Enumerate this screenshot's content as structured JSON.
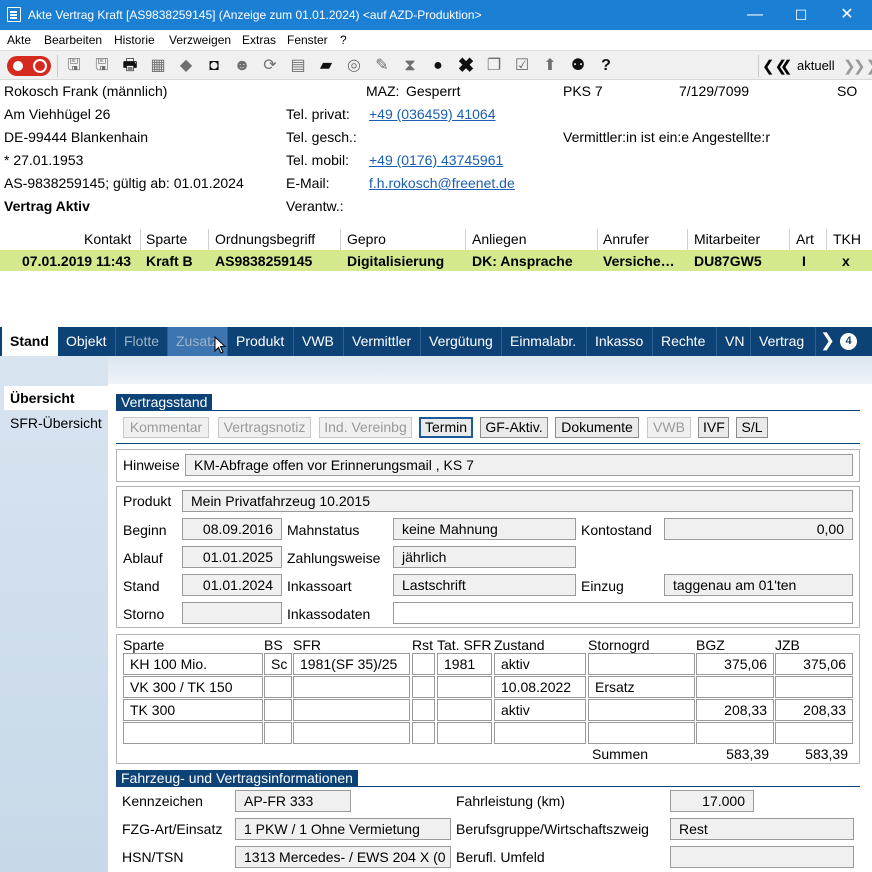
{
  "window": {
    "title": "Akte Vertrag Kraft [AS9838259145] (Anzeige zum 01.01.2024) <auf AZD-Produktion>",
    "min": "—",
    "max": "☐",
    "close": "✕"
  },
  "menu": [
    "Akte",
    "Bearbeiten",
    "Historie",
    "Verzweigen",
    "Extras",
    "Fenster",
    "?"
  ],
  "toolbar": {
    "icons": [
      "save-icon",
      "save-as-icon",
      "print-icon",
      "calculator-icon",
      "tag-icon",
      "note-icon",
      "agent-icon",
      "refresh-icon",
      "document-icon",
      "folder-icon",
      "coins-icon",
      "edit-document-icon",
      "hourglass-icon",
      "person-icon",
      "x-cross-icon",
      "copy-icon",
      "checklist-icon",
      "arrow-up-icon",
      "group-icon",
      "help-icon"
    ],
    "nav_first": "❮❮",
    "nav_prev": "❮",
    "nav_label": "aktuell",
    "nav_next": "❯",
    "nav_last": "❯❯"
  },
  "header": {
    "name": "Rokosch Frank (männlich)",
    "street": "Am Viehhügel 26",
    "city": "DE-99444 Blankenhain",
    "birth": "* 27.01.1953",
    "contract": "AS-9838259145; gültig ab: 01.01.2024",
    "status": "Vertrag Aktiv",
    "maz_label": "MAZ:",
    "maz_value": "Gesperrt",
    "pks": "PKS 7",
    "code": "7/129/7099",
    "so": "SO",
    "tel_privat_label": "Tel. privat:",
    "tel_privat": "+49 (036459) 41064",
    "tel_gesch_label": "Tel. gesch.:",
    "tel_mobil_label": "Tel. mobil:",
    "tel_mobil": "+49 (0176) 43745961",
    "email_label": "E-Mail:",
    "email": "f.h.rokosch@freenet.de",
    "verantw_label": "Verantw.:",
    "vermittler": "Vermittler:in ist ein:e Angestellte:r"
  },
  "grid": {
    "columns": [
      "Kontakt",
      "Sparte",
      "Ordnungsbegriff",
      "Gepro",
      "Anliegen",
      "Anrufer",
      "Mitarbeiter",
      "Art",
      "TKH"
    ],
    "row": [
      "07.01.2019 11:43",
      "Kraft B",
      "AS9838259145",
      "Digitalisierung",
      "DK: Ansprache",
      "Versiche…",
      "DU87GW5",
      "I",
      "x"
    ]
  },
  "tabs": [
    "Stand",
    "Objekt",
    "Flotte",
    "Zusatz",
    "Produkt",
    "VWB",
    "Vermittler",
    "Vergütung",
    "Einmalabr.",
    "Inkasso",
    "Rechte",
    "VN",
    "Vertrag"
  ],
  "tab_count": "4",
  "leftnav": [
    "Übersicht",
    "SFR-Übersicht"
  ],
  "vertragsstand": {
    "title": "Vertragsstand",
    "buttons": [
      "Kommentar",
      "Vertragsnotiz",
      "Ind. Vereinbg",
      "Termin",
      "GF-Aktiv.",
      "Dokumente",
      "VWB",
      "IVF",
      "S/L"
    ],
    "hinweise_label": "Hinweise",
    "hinweise": "KM-Abfrage offen vor Erinnerungsmail , KS 7",
    "produkt_label": "Produkt",
    "produkt": "Mein Privatfahrzeug 10.2015",
    "beginn_label": "Beginn",
    "beginn": "08.09.2016",
    "ablauf_label": "Ablauf",
    "ablauf": "01.01.2025",
    "stand_label": "Stand",
    "stand": "01.01.2024",
    "storno_label": "Storno",
    "storno": "",
    "mahnstatus_label": "Mahnstatus",
    "mahnstatus": "keine Mahnung",
    "zahlungsweise_label": "Zahlungsweise",
    "zahlungsweise": "jährlich",
    "inkassoart_label": "Inkassoart",
    "inkassoart": "Lastschrift",
    "inkassodaten_label": "Inkassodaten",
    "inkassodaten": "",
    "kontostand_label": "Kontostand",
    "kontostand": "0,00",
    "einzug_label": "Einzug",
    "einzug": "taggenau am 01'ten"
  },
  "sparten": {
    "headers": [
      "Sparte",
      "BS",
      "SFR",
      "Rst",
      "Tat. SFR",
      "Zustand",
      "Stornogrd",
      "BGZ",
      "JZB"
    ],
    "rows": [
      [
        "KH 100 Mio.",
        "Sc",
        "1981(SF 35)/25",
        "",
        "1981",
        "aktiv",
        "",
        "375,06",
        "375,06"
      ],
      [
        "VK 300 / TK 150",
        "",
        "",
        "",
        "",
        "10.08.2022",
        "Ersatz",
        "",
        ""
      ],
      [
        "TK 300",
        "",
        "",
        "",
        "",
        "aktiv",
        "",
        "208,33",
        "208,33"
      ],
      [
        "",
        "",
        "",
        "",
        "",
        "",
        "",
        "",
        ""
      ]
    ],
    "sum_label": "Summen",
    "sum_bgz": "583,39",
    "sum_jzb": "583,39"
  },
  "fahrzeug": {
    "title": "Fahrzeug- und Vertragsinformationen",
    "kennzeichen_label": "Kennzeichen",
    "kennzeichen": "AP-FR 333",
    "fzg_label": "FZG-Art/Einsatz",
    "fzg": "1 PKW / 1 Ohne Vermietung",
    "hsn_label": "HSN/TSN",
    "hsn": "1313 Mercedes- / EWS 204 X (0",
    "fahrleistung_label": "Fahrleistung (km)",
    "fahrleistung": "17.000",
    "berufsgruppe_label": "Berufsgruppe/Wirtschaftszweig",
    "berufsgruppe": "Rest",
    "umfeld_label": "Berufl. Umfeld",
    "umfeld": ""
  }
}
